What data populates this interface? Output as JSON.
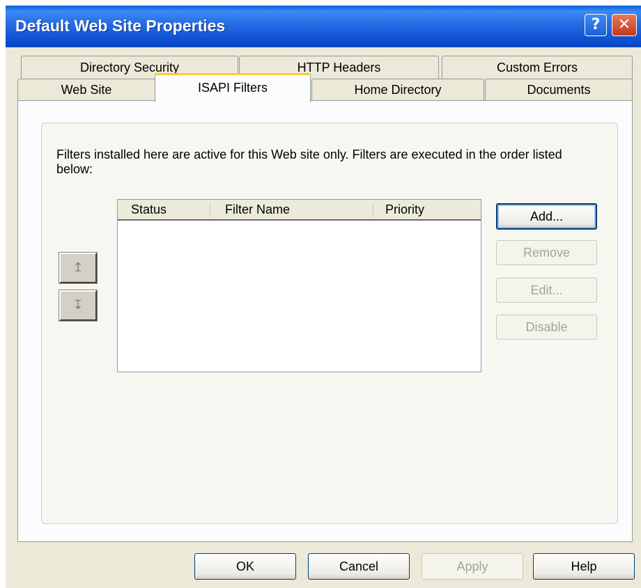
{
  "window": {
    "title": "Default Web Site Properties"
  },
  "titlebar": {
    "help_glyph": "?",
    "close_glyph": "✕"
  },
  "tabs": {
    "back_row": [
      "Directory Security",
      "HTTP Headers",
      "Custom Errors"
    ],
    "front_row": [
      "Web Site",
      "ISAPI Filters",
      "Home Directory",
      "Documents"
    ],
    "active": "ISAPI Filters"
  },
  "panel": {
    "description": "Filters installed here are active for this Web site only. Filters are executed in the order listed below:",
    "columns": [
      "Status",
      "Filter Name",
      "Priority"
    ],
    "rows": [],
    "move_up_glyph": "↥",
    "move_down_glyph": "↧",
    "buttons": {
      "add": "Add...",
      "remove": "Remove",
      "edit": "Edit...",
      "disable": "Disable"
    }
  },
  "footer": {
    "ok": "OK",
    "cancel": "Cancel",
    "apply": "Apply",
    "help": "Help"
  },
  "colors": {
    "titlebar": "#0F54D3",
    "face": "#ECE9D8",
    "active_tab_accent": "#FFC83C",
    "disabled_text": "#A3A59A"
  },
  "icons": [
    "help-icon",
    "close-icon",
    "move-up-icon",
    "move-down-icon"
  ]
}
